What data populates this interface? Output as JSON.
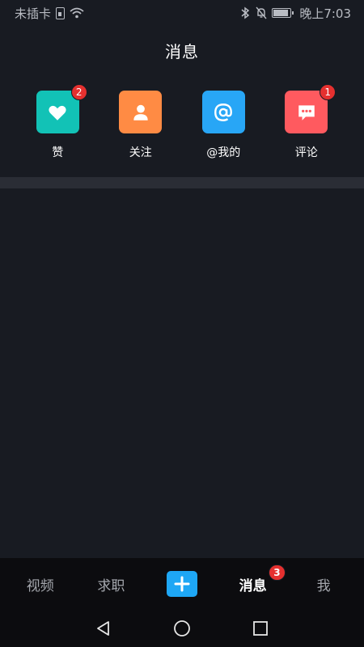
{
  "status_bar": {
    "carrier": "未插卡",
    "time": "晚上7:03"
  },
  "header": {
    "title": "消息"
  },
  "shortcuts": [
    {
      "label": "赞",
      "icon": "heart-icon",
      "color": "#12c2b6",
      "badge": "2"
    },
    {
      "label": "关注",
      "icon": "person-icon",
      "color": "#ff8b44",
      "badge": ""
    },
    {
      "label": "@我的",
      "icon": "at-icon",
      "color": "#28a6f6",
      "badge": ""
    },
    {
      "label": "评论",
      "icon": "comment-icon",
      "color": "#ff5a5f",
      "badge": "1"
    }
  ],
  "tab_bar": {
    "tabs": [
      {
        "label": "视频",
        "active": false
      },
      {
        "label": "求职",
        "active": false
      },
      {
        "label": "消息",
        "active": true,
        "badge": "3"
      },
      {
        "label": "我",
        "active": false
      }
    ],
    "plus_color": "#1ea7f5"
  }
}
